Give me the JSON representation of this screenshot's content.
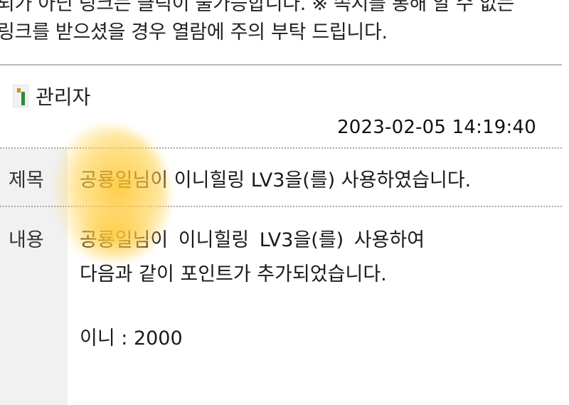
{
  "notice": {
    "line1": "되가 아닌 링크는 클릭이 불가능합니다. ※ 쪽지를 통해 알 수 없는",
    "line2": "링크를 받으셨을 경우 열람에 주의 부탁 드립니다."
  },
  "message": {
    "sender_icon": "member-rank-icon",
    "sender": "관리자",
    "date": "2023-02-05 14:19:40",
    "subject_label": "제목",
    "subject": "공룡일님이 이니힐링 LV3을(를) 사용하였습니다.",
    "content_label": "내용",
    "content_lines": [
      "공룡일님이 이니힐링 LV3을(를) 사용하여",
      "다음과 같이 포인트가 추가되었습니다.",
      "이니 : 2000"
    ]
  },
  "colors": {
    "label_bg": "#f1f1f1",
    "separator": "#b9b9b9",
    "smudge": "#ffc428"
  }
}
